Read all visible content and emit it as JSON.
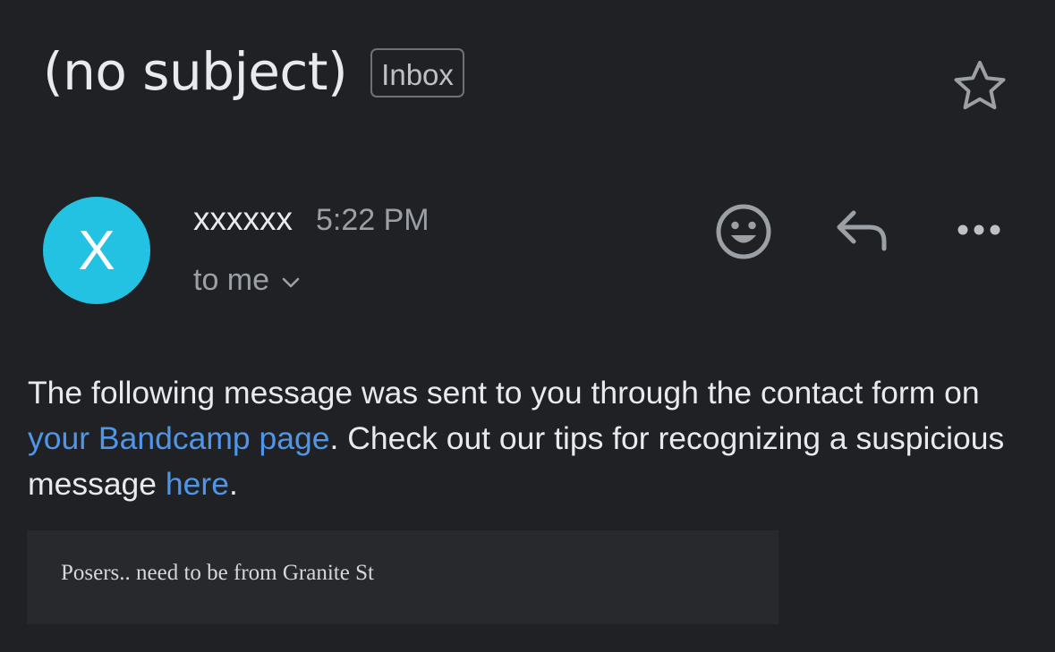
{
  "email": {
    "subject": "(no subject)",
    "label": "Inbox",
    "starred": false
  },
  "sender": {
    "avatar_letter": "X",
    "avatar_color": "#24c2e2",
    "name": "xxxxxx",
    "time": "5:22 PM",
    "recipient": "to me"
  },
  "actions": {
    "icons": [
      "star-icon",
      "emoji-icon",
      "reply-icon",
      "more-options-icon"
    ]
  },
  "body": {
    "part1": "The following message was sent to you through the contact form on ",
    "link1": "your Bandcamp page",
    "part2": ". Check out our tips for recognizing a suspicious message ",
    "link2": "here",
    "part3": ".",
    "link_color": "#4f96e8"
  },
  "quoted_message": {
    "text": "Posers.. need to be from Granite St"
  }
}
